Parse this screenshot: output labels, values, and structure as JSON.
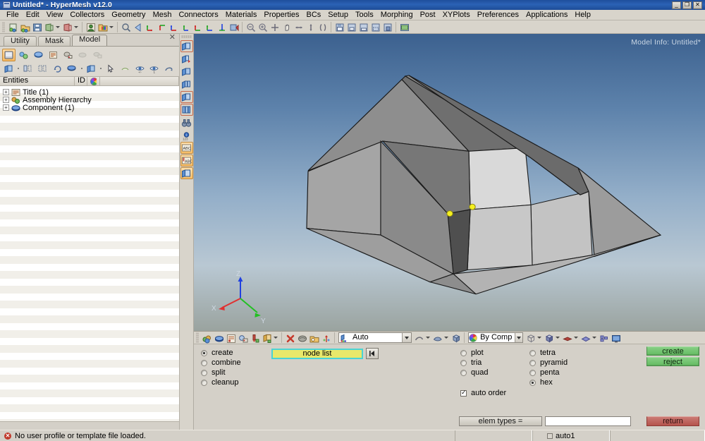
{
  "window": {
    "title": "Untitled* - HyperMesh v12.0",
    "icon": "window-icon",
    "buttons": [
      {
        "name": "minimize",
        "glyph": "_"
      },
      {
        "name": "restore",
        "glyph": "❐"
      },
      {
        "name": "close",
        "glyph": "✕"
      }
    ]
  },
  "menu": {
    "items": [
      "File",
      "Edit",
      "View",
      "Collectors",
      "Geometry",
      "Mesh",
      "Connectors",
      "Materials",
      "Properties",
      "BCs",
      "Setup",
      "Tools",
      "Morphing",
      "Post",
      "XYPlots",
      "Preferences",
      "Applications",
      "Help"
    ]
  },
  "toolbar": {
    "groups": [
      [
        "new-model-icon",
        "open-model-icon",
        "save-model-icon",
        "import-icon",
        "import-dropdown",
        "export-icon",
        "export-dropdown"
      ],
      [
        "user-profile-icon",
        "load-collector-icon",
        "collector-dropdown"
      ],
      [
        "zoom-find-icon",
        "back-arrow-icon",
        "view-xy-icon",
        "view-yx-icon",
        "view-xz-icon",
        "view-zx-icon",
        "view-yz-icon",
        "view-zy-icon",
        "view-iso-icon",
        "view-normal-icon"
      ],
      [
        "zoom-out-icon",
        "zoom-in-icon",
        "fit-icon",
        "pan-icon",
        "rotate-h-icon",
        "rotate-v-icon",
        "rotate-free-icon"
      ],
      [
        "save-view-icon",
        "view1-icon",
        "view2-icon",
        "view3-icon",
        "view4-icon"
      ],
      [
        "capture-image-icon"
      ]
    ]
  },
  "browser": {
    "tabs": [
      {
        "label": "Utility",
        "active": false
      },
      {
        "label": "Mask",
        "active": false
      },
      {
        "label": "Model",
        "active": true
      }
    ],
    "close_glyph": "✕",
    "toolbar_row1": [
      "model-browser-icon",
      "assembly-icon",
      "component-icon",
      "title-icon",
      "include-icon",
      "ghost1-icon",
      "ghost2-icon"
    ],
    "toolbar_row2": [
      "folder-icon",
      "folder-dropdown",
      "expand-all-icon",
      "collapse-all-icon",
      "refresh-icon",
      "component-sphere-icon",
      "comp-dropdown",
      "folder2-icon",
      "folder2-dropdown",
      "cursor-icon",
      "iso-icon",
      "display-all-icon",
      "display-one-icon",
      "display-reverse-icon"
    ],
    "columns": [
      {
        "label": "Entities",
        "name": "entities-column"
      },
      {
        "label": "ID",
        "name": "id-column"
      },
      {
        "label": "",
        "name": "color-column"
      }
    ],
    "tree": [
      {
        "label": "Title (1)",
        "icon": "title-icon",
        "expander": "+"
      },
      {
        "label": "Assembly Hierarchy",
        "icon": "assembly-icon",
        "expander": "+"
      },
      {
        "label": "Component (1)",
        "icon": "component-icon",
        "expander": "+"
      }
    ]
  },
  "vertical_toolbar": {
    "buttons": [
      "page-new-icon",
      "page-delete-icon",
      "page-prev-icon",
      "page-list-icon",
      "page-current-icon",
      "page-layout-icon",
      "binoculars-icon",
      "info-icon",
      "123-icon",
      "abc-note-icon",
      "abc-text-icon",
      "view-panel-icon"
    ]
  },
  "viewport": {
    "model_info": "Model Info: Untitled*",
    "triad": {
      "x_label": "X",
      "y_label": "Y",
      "z_label": "Z",
      "x_color": "#e03030",
      "y_color": "#22c022",
      "z_color": "#2040e0"
    },
    "node_markers_color": "#f5f020"
  },
  "panel": {
    "toolbar": {
      "icons_left": [
        "mesh-collector-icon",
        "elem-collector-icon",
        "card-icon",
        "delete-mesh-icon",
        "drop-icon",
        "translate-icon",
        "translate-dropdown",
        "delete-x-icon",
        "shrink-icon",
        "organize-icon",
        "normals-icon"
      ],
      "mesh_mode": {
        "label": "Auto",
        "icon": "mesh-mode-icon"
      },
      "shape_icons": [
        "line-shape-icon",
        "surf-shape-icon",
        "solid-shape-icon"
      ],
      "color_mode": {
        "label": "By Comp",
        "icon": "color-wheel-icon"
      },
      "right_icons": [
        "wireframe-icon",
        "shaded-icon",
        "feature-icon",
        "transparent-icon",
        "elem-icon",
        "screen-icon"
      ]
    },
    "operations": [
      {
        "label": "create",
        "selected": true
      },
      {
        "label": "combine",
        "selected": false
      },
      {
        "label": "split",
        "selected": false
      },
      {
        "label": "cleanup",
        "selected": false
      }
    ],
    "node_list": {
      "label": "node list",
      "name": "node-list-field"
    },
    "rewind_button": {
      "glyph": "◀❘",
      "name": "rewind-button"
    },
    "element_2d": [
      {
        "label": "plot",
        "selected": false
      },
      {
        "label": "tria",
        "selected": false
      },
      {
        "label": "quad",
        "selected": false
      }
    ],
    "element_3d": [
      {
        "label": "tetra",
        "selected": false
      },
      {
        "label": "pyramid",
        "selected": false
      },
      {
        "label": "penta",
        "selected": false
      },
      {
        "label": "hex",
        "selected": true
      }
    ],
    "auto_order": {
      "label": "auto order",
      "checked": true
    },
    "elem_types_button": "elem types =",
    "elem_types_value": "",
    "action_buttons": [
      {
        "label": "create",
        "style": "green",
        "name": "create-button"
      },
      {
        "label": "reject",
        "style": "green",
        "name": "reject-button"
      }
    ],
    "return_button": {
      "label": "return",
      "style": "red",
      "name": "return-button"
    }
  },
  "statusbar": {
    "message": "No user profile or template file loaded.",
    "error_icon": "error-icon",
    "auto_save": "auto1"
  },
  "colors": {
    "titlebar_blue": "#22559f",
    "panel_grey": "#d4d0c8",
    "yellow_field": "#e9e86a",
    "cyan_border": "#4ad4d4",
    "green_button": "#6fc36d",
    "red_button": "#b4534c"
  }
}
